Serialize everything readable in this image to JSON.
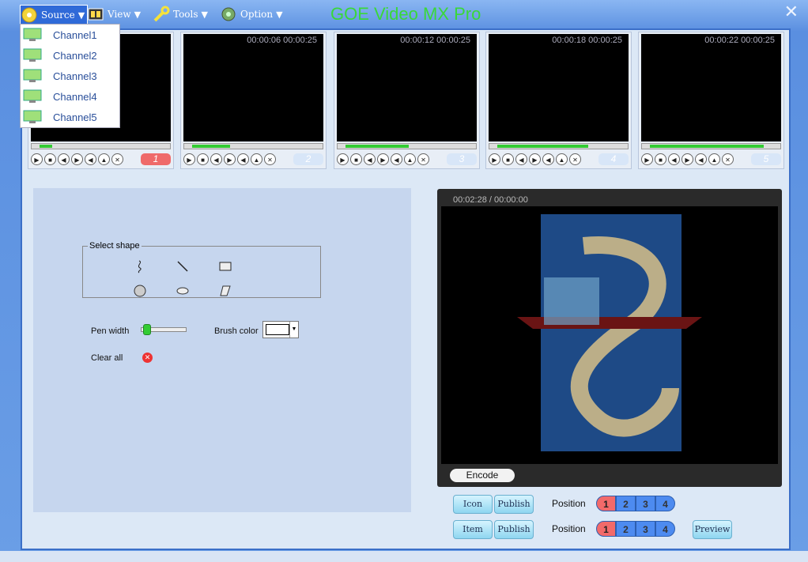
{
  "app": {
    "title": "GOE Video MX Pro",
    "close_glyph": "✕"
  },
  "menu": {
    "source": "Source",
    "view": "View",
    "tools": "Tools",
    "option": "Option",
    "arrow": "▼"
  },
  "source_dropdown": {
    "items": [
      "Channel1",
      "Channel2",
      "Channel3",
      "Channel4",
      "Channel5"
    ]
  },
  "channels": [
    {
      "time": "",
      "number": "1",
      "active": true,
      "progress": 0.1
    },
    {
      "time": "00:00:06 00:00:25",
      "number": "2",
      "active": false,
      "progress": 0.3
    },
    {
      "time": "00:00:12 00:00:25",
      "number": "3",
      "active": false,
      "progress": 0.5
    },
    {
      "time": "00:00:18 00:00:25",
      "number": "4",
      "active": false,
      "progress": 0.72
    },
    {
      "time": "00:00:22 00:00:25",
      "number": "5",
      "active": false,
      "progress": 0.9
    }
  ],
  "controls": {
    "play": "▶",
    "stop": "■",
    "prev": "◀",
    "next": "▶",
    "mute": "◀",
    "eject": "▲",
    "close": "✕"
  },
  "shape_panel": {
    "legend": "Select shape",
    "pen_width_label": "Pen width",
    "brush_color_label": "Brush color",
    "clear_all_label": "Clear all",
    "clear_glyph": "✕",
    "pen_width_level": 0.1
  },
  "preview": {
    "time": "00:02:28 / 00:00:00",
    "encode_label": "Encode"
  },
  "publish_rows": [
    {
      "first_label": "Icon",
      "publish_label": "Publish",
      "position_label": "Position",
      "positions": [
        "1",
        "2",
        "3",
        "4"
      ]
    },
    {
      "first_label": "Item",
      "publish_label": "Publish",
      "position_label": "Position",
      "positions": [
        "1",
        "2",
        "3",
        "4"
      ]
    }
  ],
  "preview_button": "Preview",
  "colors": {
    "title_green": "#39d839",
    "menu_active": "#2f6ad8",
    "panel": "#c6d6ee"
  }
}
